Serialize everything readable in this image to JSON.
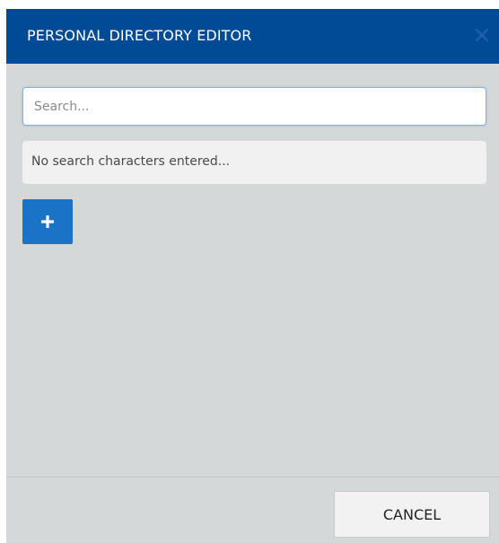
{
  "dialog": {
    "title": "PERSONAL DIRECTORY EDITOR",
    "close_icon": "close-icon"
  },
  "search": {
    "placeholder": "Search...",
    "value": ""
  },
  "results": {
    "message": "No search characters entered..."
  },
  "add_button": {
    "icon": "plus-icon"
  },
  "footer": {
    "cancel_label": "CANCEL"
  },
  "colors": {
    "header_bg": "#004a96",
    "dialog_bg": "#d5d8d9",
    "add_button_bg": "#1a73c7"
  }
}
